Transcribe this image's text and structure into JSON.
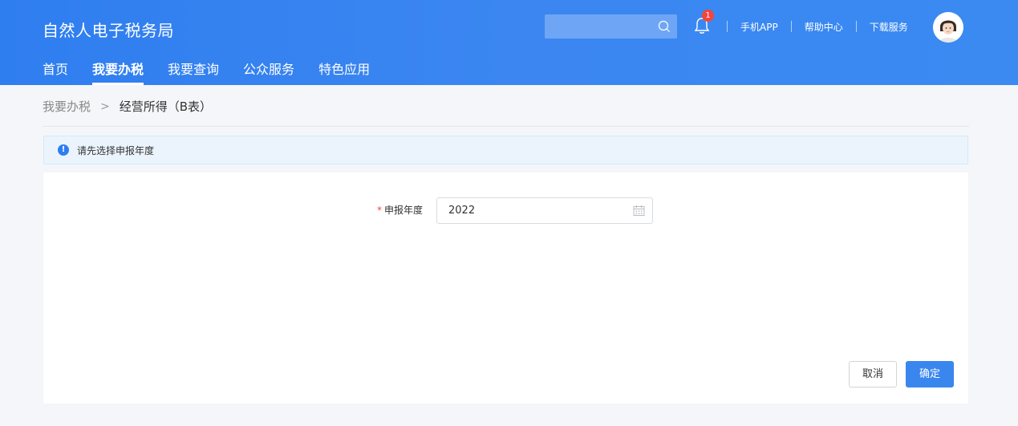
{
  "header": {
    "app_title": "自然人电子税务局",
    "notification_count": "1",
    "links": [
      "手机APP",
      "帮助中心",
      "下载服务"
    ],
    "nav": [
      "首页",
      "我要办税",
      "我要查询",
      "公众服务",
      "特色应用"
    ],
    "active_nav": "我要办税"
  },
  "breadcrumb": {
    "root": "我要办税",
    "separator": ">",
    "current": "经营所得（B表）"
  },
  "alert": {
    "icon": "!",
    "text": "请先选择申报年度"
  },
  "form": {
    "required_mark": "*",
    "year_label": "申报年度",
    "year_value": "2022"
  },
  "buttons": {
    "cancel": "取消",
    "confirm": "确定"
  },
  "colors": {
    "header_blue": "#2f7ef0",
    "primary": "#3a86ef",
    "badge": "#f5443b"
  }
}
